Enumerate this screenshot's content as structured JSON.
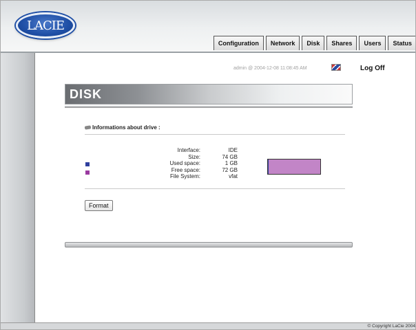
{
  "brand": {
    "logo_text": "LACIE"
  },
  "tabs": [
    {
      "label": "Configuration"
    },
    {
      "label": "Network"
    },
    {
      "label": "Disk"
    },
    {
      "label": "Shares"
    },
    {
      "label": "Users"
    },
    {
      "label": "Status"
    }
  ],
  "session": {
    "status_text": "admin @ 2004-12-08 11:08:45 AM",
    "logoff_label": "Log Off"
  },
  "page": {
    "title": "DISK"
  },
  "drive_info": {
    "heading": "Informations about drive :",
    "rows": [
      {
        "label": "Interface:",
        "value": "IDE"
      },
      {
        "label": "Size:",
        "value": "74 GB"
      },
      {
        "label": "Used space:",
        "value": "1 GB"
      },
      {
        "label": "Free space:",
        "value": "72 GB"
      },
      {
        "label": "File System:",
        "value": "vfat"
      }
    ],
    "usage": {
      "used_fraction": 0.014
    },
    "colors": {
      "used": "#2f3f9e",
      "free": "#c285c7"
    }
  },
  "actions": {
    "format_label": "Format"
  },
  "footer": {
    "copyright": "© Copyright LaCie 2004"
  }
}
